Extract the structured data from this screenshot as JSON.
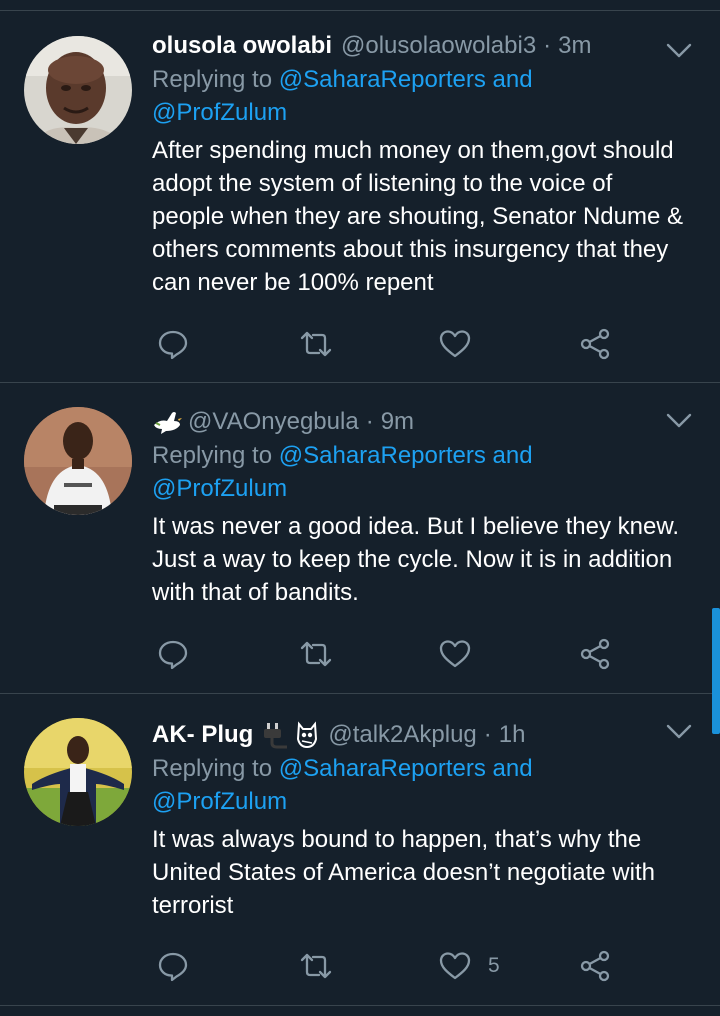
{
  "tweets": [
    {
      "name": "olusola owolabi",
      "badges": [],
      "handle": "@olusolaowolabi3",
      "separator": "·",
      "time": "3m",
      "replying_prefix": "Replying to",
      "replying_to_1": "@SaharaReporters and",
      "replying_to_2": "@ProfZulum",
      "text_lines": [
        "After spending much money on them,govt should",
        "adopt the system of listening to the voice of",
        "people when they are shouting, Senator Ndume &",
        "others comments about this insurgency that they",
        "can never be 100% repent"
      ],
      "like_count": ""
    },
    {
      "name": "",
      "badges": [
        "dove-emoji"
      ],
      "handle": "@VAOnyegbula",
      "separator": "·",
      "time": "9m",
      "replying_prefix": "Replying to",
      "replying_to_1": "@SaharaReporters and",
      "replying_to_2": "@ProfZulum",
      "text_lines": [
        "It was never a good idea. But I believe they knew.",
        "Just a way to keep the cycle. Now it is in addition",
        "with that of bandits."
      ],
      "like_count": ""
    },
    {
      "name": "AK- Plug",
      "badges": [
        "plug-emoji",
        "owl-emoji"
      ],
      "handle": "@talk2Akplug",
      "separator": "·",
      "time": "1h",
      "replying_prefix": "Replying to",
      "replying_to_1": "@SaharaReporters and",
      "replying_to_2": "@ProfZulum",
      "text_lines": [
        "It was always bound to happen, that’s why the",
        "United States of America doesn’t negotiate with",
        "terrorist"
      ],
      "like_count": "5"
    }
  ],
  "icons": {
    "reply": "reply-icon",
    "retweet": "retweet-icon",
    "like": "heart-icon",
    "share": "share-icon",
    "menu": "chevron-down-icon"
  },
  "colors": {
    "background": "#15202b",
    "divider": "#38444d",
    "text": "#ffffff",
    "secondary": "#8899a6",
    "link": "#1da1f2",
    "scrollbar": "#1a91da"
  }
}
